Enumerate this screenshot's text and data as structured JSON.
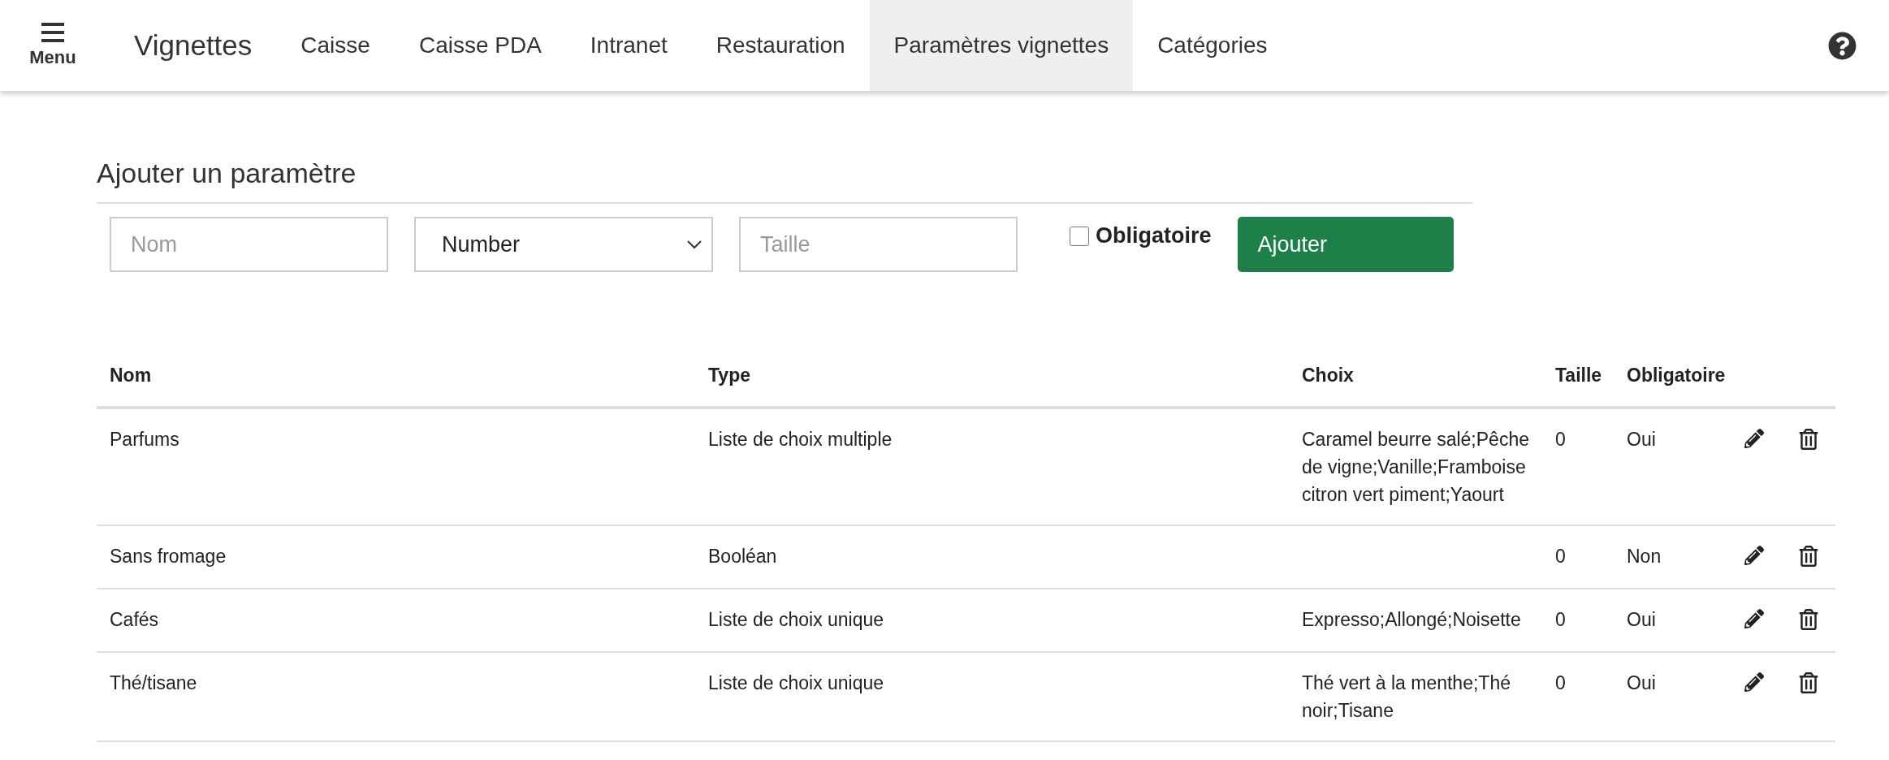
{
  "header": {
    "menu_label": "Menu",
    "brand": "Vignettes",
    "nav": [
      {
        "label": "Caisse",
        "selected": false
      },
      {
        "label": "Caisse PDA",
        "selected": false
      },
      {
        "label": "Intranet",
        "selected": false
      },
      {
        "label": "Restauration",
        "selected": false
      },
      {
        "label": "Paramètres vignettes",
        "selected": true
      },
      {
        "label": "Catégories",
        "selected": false
      }
    ]
  },
  "form": {
    "title": "Ajouter un paramètre",
    "name_field": {
      "placeholder": "Nom"
    },
    "type_select": {
      "value": "Number"
    },
    "size_field": {
      "placeholder": "Taille"
    },
    "required": {
      "label": "Obligatoire",
      "checked": false
    },
    "submit": "Ajouter"
  },
  "table": {
    "columns": [
      "Nom",
      "Type",
      "Choix",
      "Taille",
      "Obligatoire"
    ],
    "rows": [
      {
        "name": "Parfums",
        "type": "Liste de choix multiple",
        "choices": "Caramel beurre salé;Pêche de vigne;Vanille;Framboise citron vert piment;Yaourt",
        "size": "0",
        "required": "Oui"
      },
      {
        "name": "Sans fromage",
        "type": "Booléan",
        "choices": "",
        "size": "0",
        "required": "Non"
      },
      {
        "name": "Cafés",
        "type": "Liste de choix unique",
        "choices": "Expresso;Allongé;Noisette",
        "size": "0",
        "required": "Oui"
      },
      {
        "name": "Thé/tisane",
        "type": "Liste de choix unique",
        "choices": "Thé vert à la menthe;Thé noir;Tisane",
        "size": "0",
        "required": "Oui"
      }
    ]
  }
}
